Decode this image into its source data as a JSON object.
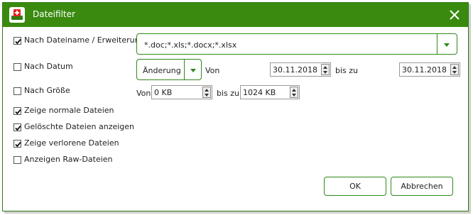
{
  "window": {
    "title": "Dateifilter"
  },
  "filters": {
    "name_ext": {
      "label": "Nach Dateiname / Erweiterung",
      "checked": true
    },
    "date": {
      "label": "Nach Datum",
      "checked": false
    },
    "size": {
      "label": "Nach Größe",
      "checked": false
    },
    "normal": {
      "label": "Zeige normale Dateien",
      "checked": true
    },
    "deleted": {
      "label": "Gelöschte Dateien anzeigen",
      "checked": true
    },
    "lost": {
      "label": "Zeige verlorene Dateien",
      "checked": true
    },
    "raw": {
      "label": "Anzeigen Raw-Dateien",
      "checked": false
    }
  },
  "extensions": {
    "value": "*.doc;*.xls;*.docx;*.xlsx"
  },
  "date_filter": {
    "type": "Änderung",
    "from_label": "Von",
    "from": "30.11.2018",
    "to_label": "bis zu",
    "to": "30.11.2018"
  },
  "size_filter": {
    "from_label": "Von",
    "from": "0 KB",
    "to_label": "bis zu",
    "to": "1024 KB"
  },
  "buttons": {
    "ok": "OK",
    "cancel": "Abbrechen"
  },
  "colors": {
    "accent": "#3a8a0f",
    "border": "#2f8a1a"
  }
}
